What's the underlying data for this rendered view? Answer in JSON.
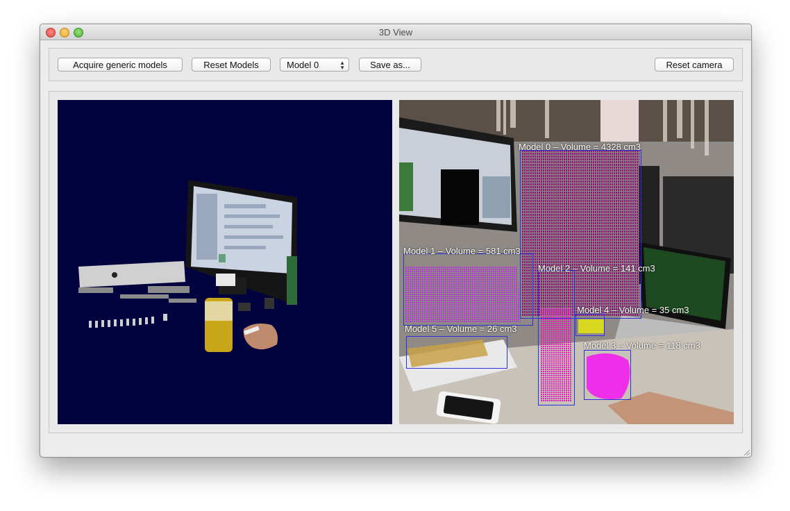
{
  "window": {
    "title": "3D View"
  },
  "toolbar": {
    "acquire_label": "Acquire generic models",
    "reset_models_label": "Reset Models",
    "model_select_value": "Model 0",
    "save_label": "Save as...",
    "reset_camera_label": "Reset camera"
  },
  "camera_view": {
    "models": [
      {
        "label": "Model 0 – Volume = 4328 cm3"
      },
      {
        "label": "Model 1 – Volume = 581 cm3"
      },
      {
        "label": "Model 2 – Volume = 141 cm3"
      },
      {
        "label": "Model 4 – Volume = 35 cm3"
      },
      {
        "label": "Model 5 – Volume = 26 cm3"
      },
      {
        "label": "Model 3 – Volume = 118 cm3"
      }
    ]
  },
  "colors": {
    "view3d_background": "#02033e",
    "bbox_stroke": "#2b2fe0",
    "model0_points": "#8a1a7a",
    "model1_points": "#b23ad0",
    "model2_points": "#e020b8",
    "model3_points": "#ee2ee8",
    "model4_points": "#d8d820",
    "model5_points": "#c8a048"
  }
}
